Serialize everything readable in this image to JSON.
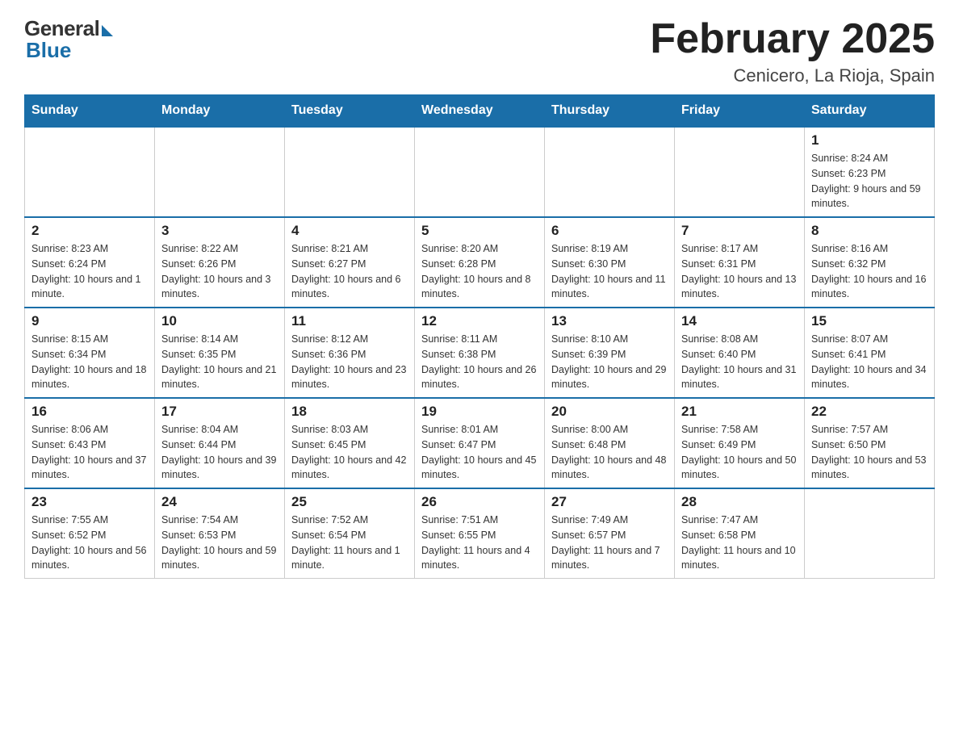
{
  "logo": {
    "general": "General",
    "blue": "Blue"
  },
  "title": "February 2025",
  "subtitle": "Cenicero, La Rioja, Spain",
  "weekdays": [
    "Sunday",
    "Monday",
    "Tuesday",
    "Wednesday",
    "Thursday",
    "Friday",
    "Saturday"
  ],
  "weeks": [
    [
      {
        "day": "",
        "info": ""
      },
      {
        "day": "",
        "info": ""
      },
      {
        "day": "",
        "info": ""
      },
      {
        "day": "",
        "info": ""
      },
      {
        "day": "",
        "info": ""
      },
      {
        "day": "",
        "info": ""
      },
      {
        "day": "1",
        "info": "Sunrise: 8:24 AM\nSunset: 6:23 PM\nDaylight: 9 hours and 59 minutes."
      }
    ],
    [
      {
        "day": "2",
        "info": "Sunrise: 8:23 AM\nSunset: 6:24 PM\nDaylight: 10 hours and 1 minute."
      },
      {
        "day": "3",
        "info": "Sunrise: 8:22 AM\nSunset: 6:26 PM\nDaylight: 10 hours and 3 minutes."
      },
      {
        "day": "4",
        "info": "Sunrise: 8:21 AM\nSunset: 6:27 PM\nDaylight: 10 hours and 6 minutes."
      },
      {
        "day": "5",
        "info": "Sunrise: 8:20 AM\nSunset: 6:28 PM\nDaylight: 10 hours and 8 minutes."
      },
      {
        "day": "6",
        "info": "Sunrise: 8:19 AM\nSunset: 6:30 PM\nDaylight: 10 hours and 11 minutes."
      },
      {
        "day": "7",
        "info": "Sunrise: 8:17 AM\nSunset: 6:31 PM\nDaylight: 10 hours and 13 minutes."
      },
      {
        "day": "8",
        "info": "Sunrise: 8:16 AM\nSunset: 6:32 PM\nDaylight: 10 hours and 16 minutes."
      }
    ],
    [
      {
        "day": "9",
        "info": "Sunrise: 8:15 AM\nSunset: 6:34 PM\nDaylight: 10 hours and 18 minutes."
      },
      {
        "day": "10",
        "info": "Sunrise: 8:14 AM\nSunset: 6:35 PM\nDaylight: 10 hours and 21 minutes."
      },
      {
        "day": "11",
        "info": "Sunrise: 8:12 AM\nSunset: 6:36 PM\nDaylight: 10 hours and 23 minutes."
      },
      {
        "day": "12",
        "info": "Sunrise: 8:11 AM\nSunset: 6:38 PM\nDaylight: 10 hours and 26 minutes."
      },
      {
        "day": "13",
        "info": "Sunrise: 8:10 AM\nSunset: 6:39 PM\nDaylight: 10 hours and 29 minutes."
      },
      {
        "day": "14",
        "info": "Sunrise: 8:08 AM\nSunset: 6:40 PM\nDaylight: 10 hours and 31 minutes."
      },
      {
        "day": "15",
        "info": "Sunrise: 8:07 AM\nSunset: 6:41 PM\nDaylight: 10 hours and 34 minutes."
      }
    ],
    [
      {
        "day": "16",
        "info": "Sunrise: 8:06 AM\nSunset: 6:43 PM\nDaylight: 10 hours and 37 minutes."
      },
      {
        "day": "17",
        "info": "Sunrise: 8:04 AM\nSunset: 6:44 PM\nDaylight: 10 hours and 39 minutes."
      },
      {
        "day": "18",
        "info": "Sunrise: 8:03 AM\nSunset: 6:45 PM\nDaylight: 10 hours and 42 minutes."
      },
      {
        "day": "19",
        "info": "Sunrise: 8:01 AM\nSunset: 6:47 PM\nDaylight: 10 hours and 45 minutes."
      },
      {
        "day": "20",
        "info": "Sunrise: 8:00 AM\nSunset: 6:48 PM\nDaylight: 10 hours and 48 minutes."
      },
      {
        "day": "21",
        "info": "Sunrise: 7:58 AM\nSunset: 6:49 PM\nDaylight: 10 hours and 50 minutes."
      },
      {
        "day": "22",
        "info": "Sunrise: 7:57 AM\nSunset: 6:50 PM\nDaylight: 10 hours and 53 minutes."
      }
    ],
    [
      {
        "day": "23",
        "info": "Sunrise: 7:55 AM\nSunset: 6:52 PM\nDaylight: 10 hours and 56 minutes."
      },
      {
        "day": "24",
        "info": "Sunrise: 7:54 AM\nSunset: 6:53 PM\nDaylight: 10 hours and 59 minutes."
      },
      {
        "day": "25",
        "info": "Sunrise: 7:52 AM\nSunset: 6:54 PM\nDaylight: 11 hours and 1 minute."
      },
      {
        "day": "26",
        "info": "Sunrise: 7:51 AM\nSunset: 6:55 PM\nDaylight: 11 hours and 4 minutes."
      },
      {
        "day": "27",
        "info": "Sunrise: 7:49 AM\nSunset: 6:57 PM\nDaylight: 11 hours and 7 minutes."
      },
      {
        "day": "28",
        "info": "Sunrise: 7:47 AM\nSunset: 6:58 PM\nDaylight: 11 hours and 10 minutes."
      },
      {
        "day": "",
        "info": ""
      }
    ]
  ]
}
